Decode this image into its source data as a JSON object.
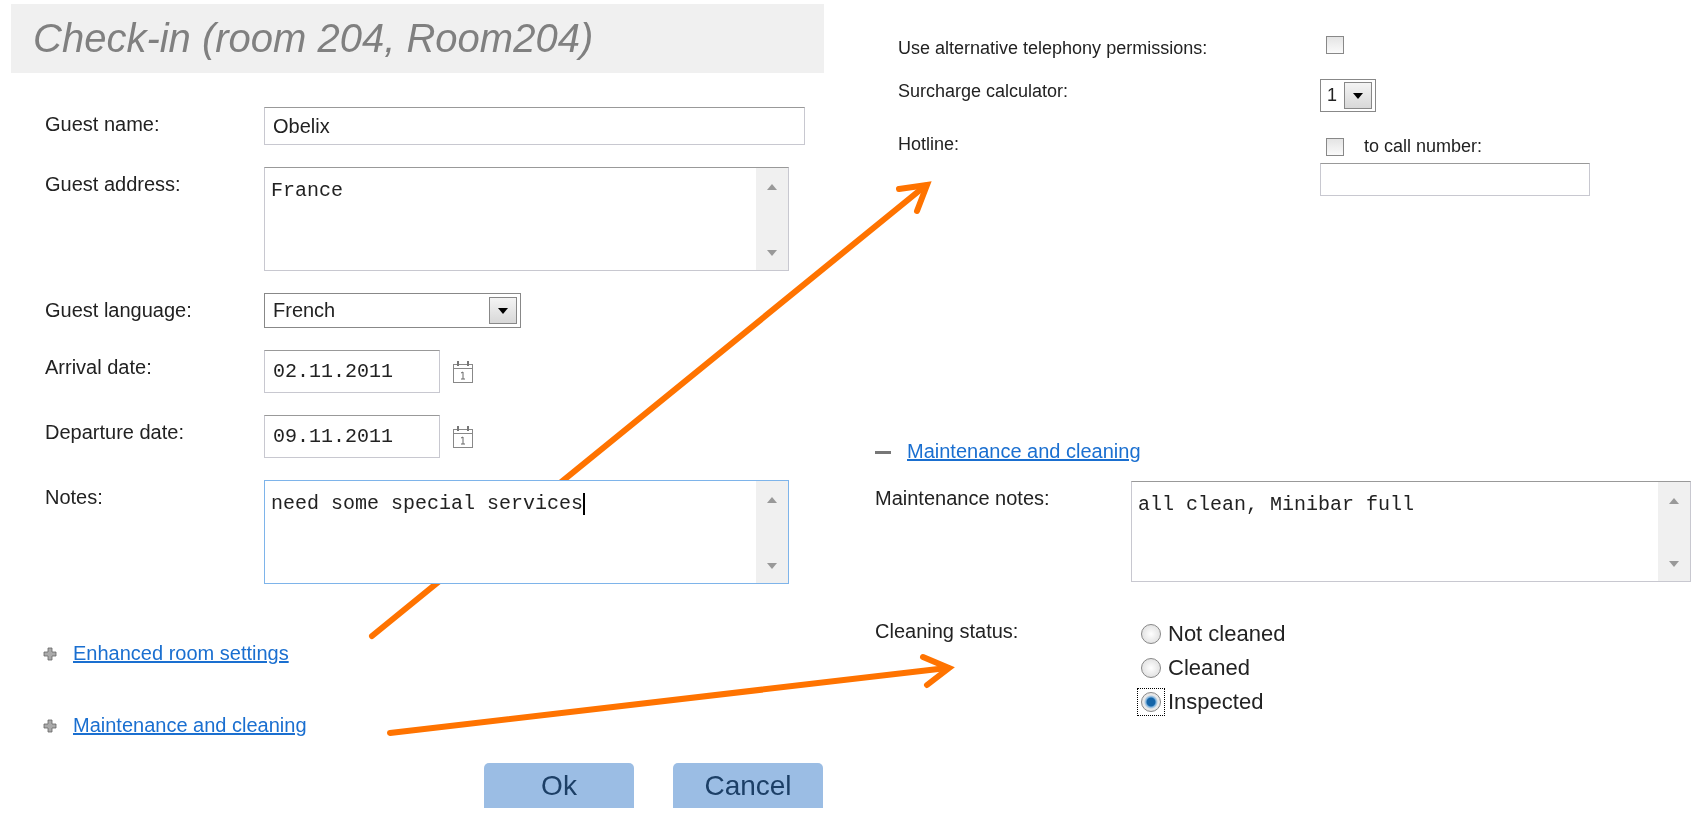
{
  "dialog": {
    "title": "Check-in (room 204, Room204)",
    "fields": [
      {
        "kind": "text",
        "label": "Guest name:",
        "value": "Obelix"
      },
      {
        "kind": "textarea",
        "label": "Guest address:",
        "value": "France"
      },
      {
        "kind": "select",
        "label": "Guest language:",
        "value": "French"
      },
      {
        "kind": "date",
        "label": "Arrival date:",
        "value": "02.11.2011"
      },
      {
        "kind": "date",
        "label": "Departure date:",
        "value": "09.11.2011"
      },
      {
        "kind": "textarea",
        "label": "Notes:",
        "value": "need some special services",
        "focused": true
      }
    ],
    "sections": [
      {
        "label": "Enhanced room settings",
        "expanded": false
      },
      {
        "label": "Maintenance and cleaning",
        "expanded": false
      }
    ],
    "buttons": [
      "Ok",
      "Cancel"
    ]
  },
  "room_settings": {
    "fields": [
      {
        "kind": "checkbox",
        "label": "Use alternative telephony permissions:",
        "checked": false
      },
      {
        "kind": "select",
        "label": "Surcharge calculator:",
        "value": "1"
      },
      {
        "kind": "hotline",
        "label": "Hotline:",
        "checked": false,
        "option_label": "to call number:"
      }
    ]
  },
  "maintenance": {
    "section": {
      "label": "Maintenance and cleaning",
      "expanded": true
    },
    "notes_label": "Maintenance notes:",
    "notes": "all clean, Minibar full",
    "status_label": "Cleaning status:",
    "statuses": [
      {
        "label": "Not cleaned",
        "selected": false
      },
      {
        "label": "Cleaned",
        "selected": false
      },
      {
        "label": "Inspected",
        "selected": true
      }
    ]
  }
}
